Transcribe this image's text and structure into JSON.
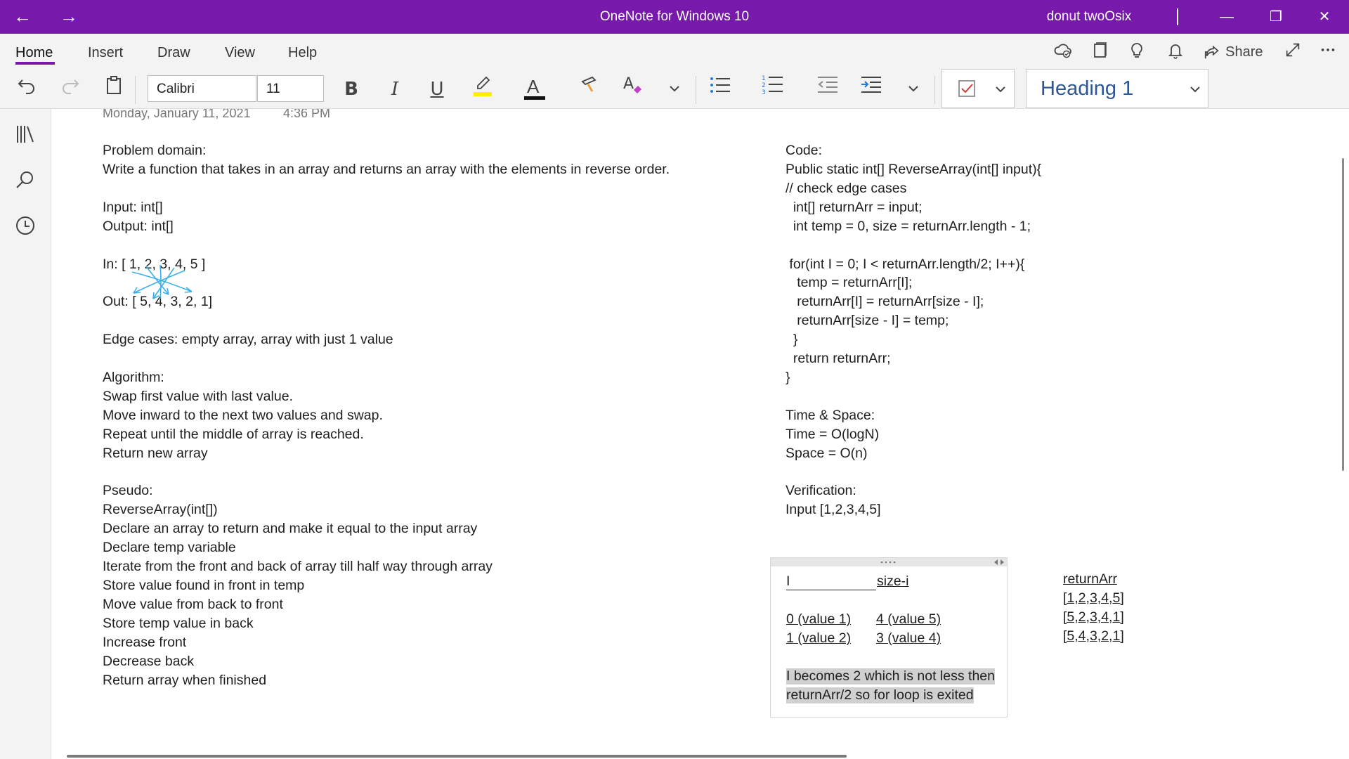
{
  "titlebar": {
    "title": "OneNote for Windows 10",
    "user": "donut twoOsix",
    "back_icon": "←",
    "forward_icon": "→",
    "minimize": "—",
    "restore": "❐",
    "close": "✕"
  },
  "menu": {
    "tabs": [
      "Home",
      "Insert",
      "Draw",
      "View",
      "Help"
    ],
    "share_label": "Share"
  },
  "ribbon": {
    "font": "Calibri",
    "size": "11",
    "bold": "B",
    "italic": "I",
    "underline": "U",
    "font_color": "A",
    "style": "Heading 1"
  },
  "page": {
    "date": "Monday, January 11, 2021",
    "time": "4:36 PM",
    "left": [
      "Problem domain:",
      "Write a function that takes in an array and returns an array with the elements in reverse order.",
      "",
      "Input: int[]",
      "Output: int[]",
      "",
      "In: [ 1, 2, 3, 4, 5 ]",
      "",
      "Out: [ 5, 4, 3, 2, 1]",
      "",
      "Edge cases: empty array, array with just 1 value",
      "",
      "Algorithm:",
      "Swap first value with last value.",
      "Move inward to the next two values and swap.",
      "Repeat until the middle of array is reached.",
      "Return new array",
      "",
      "Pseudo:",
      "ReverseArray(int[])",
      "Declare an array to return and make it equal to the input array",
      "Declare temp variable",
      "Iterate from the front and back of array till half way through array",
      "Store value found in front in temp",
      "Move value from back to front",
      "Store temp value in back",
      "Increase front",
      "Decrease back",
      "Return array when finished"
    ],
    "right": [
      "Code:",
      "Public static int[] ReverseArray(int[] input){",
      "// check edge cases",
      "  int[] returnArr = input;",
      "  int temp = 0, size = returnArr.length - 1;",
      "",
      " for(int I = 0; I < returnArr.length/2; I++){",
      "   temp = returnArr[I];",
      "   returnArr[I] = returnArr[size - I];",
      "   returnArr[size - I] = temp;",
      "  }",
      "  return returnArr;",
      "}",
      "",
      "Time & Space:",
      "Time = O(logN)",
      "Space = O(n)",
      "",
      "Verification:",
      "Input [1,2,3,4,5]"
    ],
    "table": {
      "col1_header": "I",
      "col2_header": "size-i",
      "rows": [
        {
          "i": "0 (value 1)",
          "size_i": "4 (value 5)"
        },
        {
          "i": "1 (value 2)",
          "size_i": "3 (value 4)"
        }
      ],
      "note_line1": "I becomes 2 which is not less then",
      "note_line2": "returnArr/2 so for loop is exited"
    },
    "returnArr": {
      "header": "returnArr",
      "values": [
        "[1,2,3,4,5]",
        "[5,2,3,4,1]",
        "[5,4,3,2,1]"
      ]
    }
  },
  "colors": {
    "titlebar": "#7719aa",
    "ink": "#3ab0e8",
    "heading": "#2e5797"
  }
}
